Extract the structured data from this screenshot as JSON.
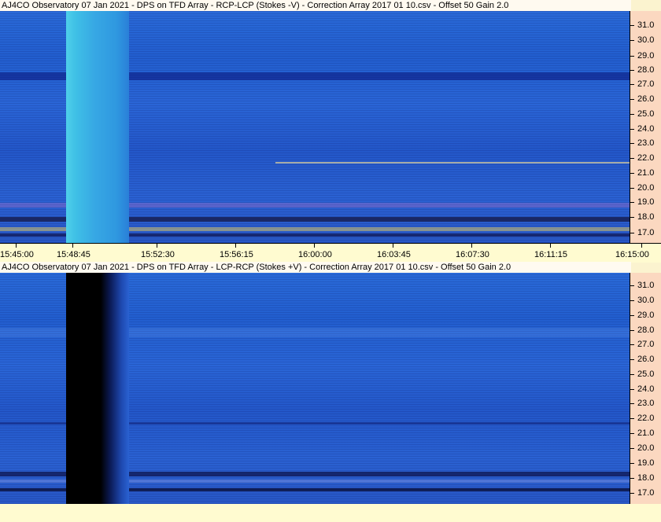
{
  "panels": [
    {
      "title": "AJ4CO Observatory 07 Jan 2021  -  DPS on TFD Array  -  RCP-LCP (Stokes -V)  -  Correction Array 2017 01 10.csv  -  Offset 50  Gain 2.0"
    },
    {
      "title": "AJ4CO Observatory 07 Jan 2021  -  DPS on TFD Array  -  LCP-RCP (Stokes +V)  -  Correction Array 2017 01 10.csv  -  Offset 50  Gain 2.0"
    }
  ],
  "y_axis": {
    "unit_ticks": [
      "31.0",
      "30.0",
      "29.0",
      "28.0",
      "27.0",
      "26.0",
      "25.0",
      "24.0",
      "23.0",
      "22.0",
      "21.0",
      "20.0",
      "19.0",
      "18.0",
      "17.0"
    ]
  },
  "x_axis": {
    "ticks": [
      "15:45:00",
      "15:48:45",
      "15:52:30",
      "15:56:15",
      "16:00:00",
      "16:03:45",
      "16:07:30",
      "16:11:15",
      "16:15:00"
    ]
  },
  "colors": {
    "background": "#fbf3cf",
    "axis_bg": "#fbd8c0",
    "spectrogram_blue": "#2a62d2",
    "burst_top": "#37c6e0",
    "burst_bottom": "#000000"
  }
}
